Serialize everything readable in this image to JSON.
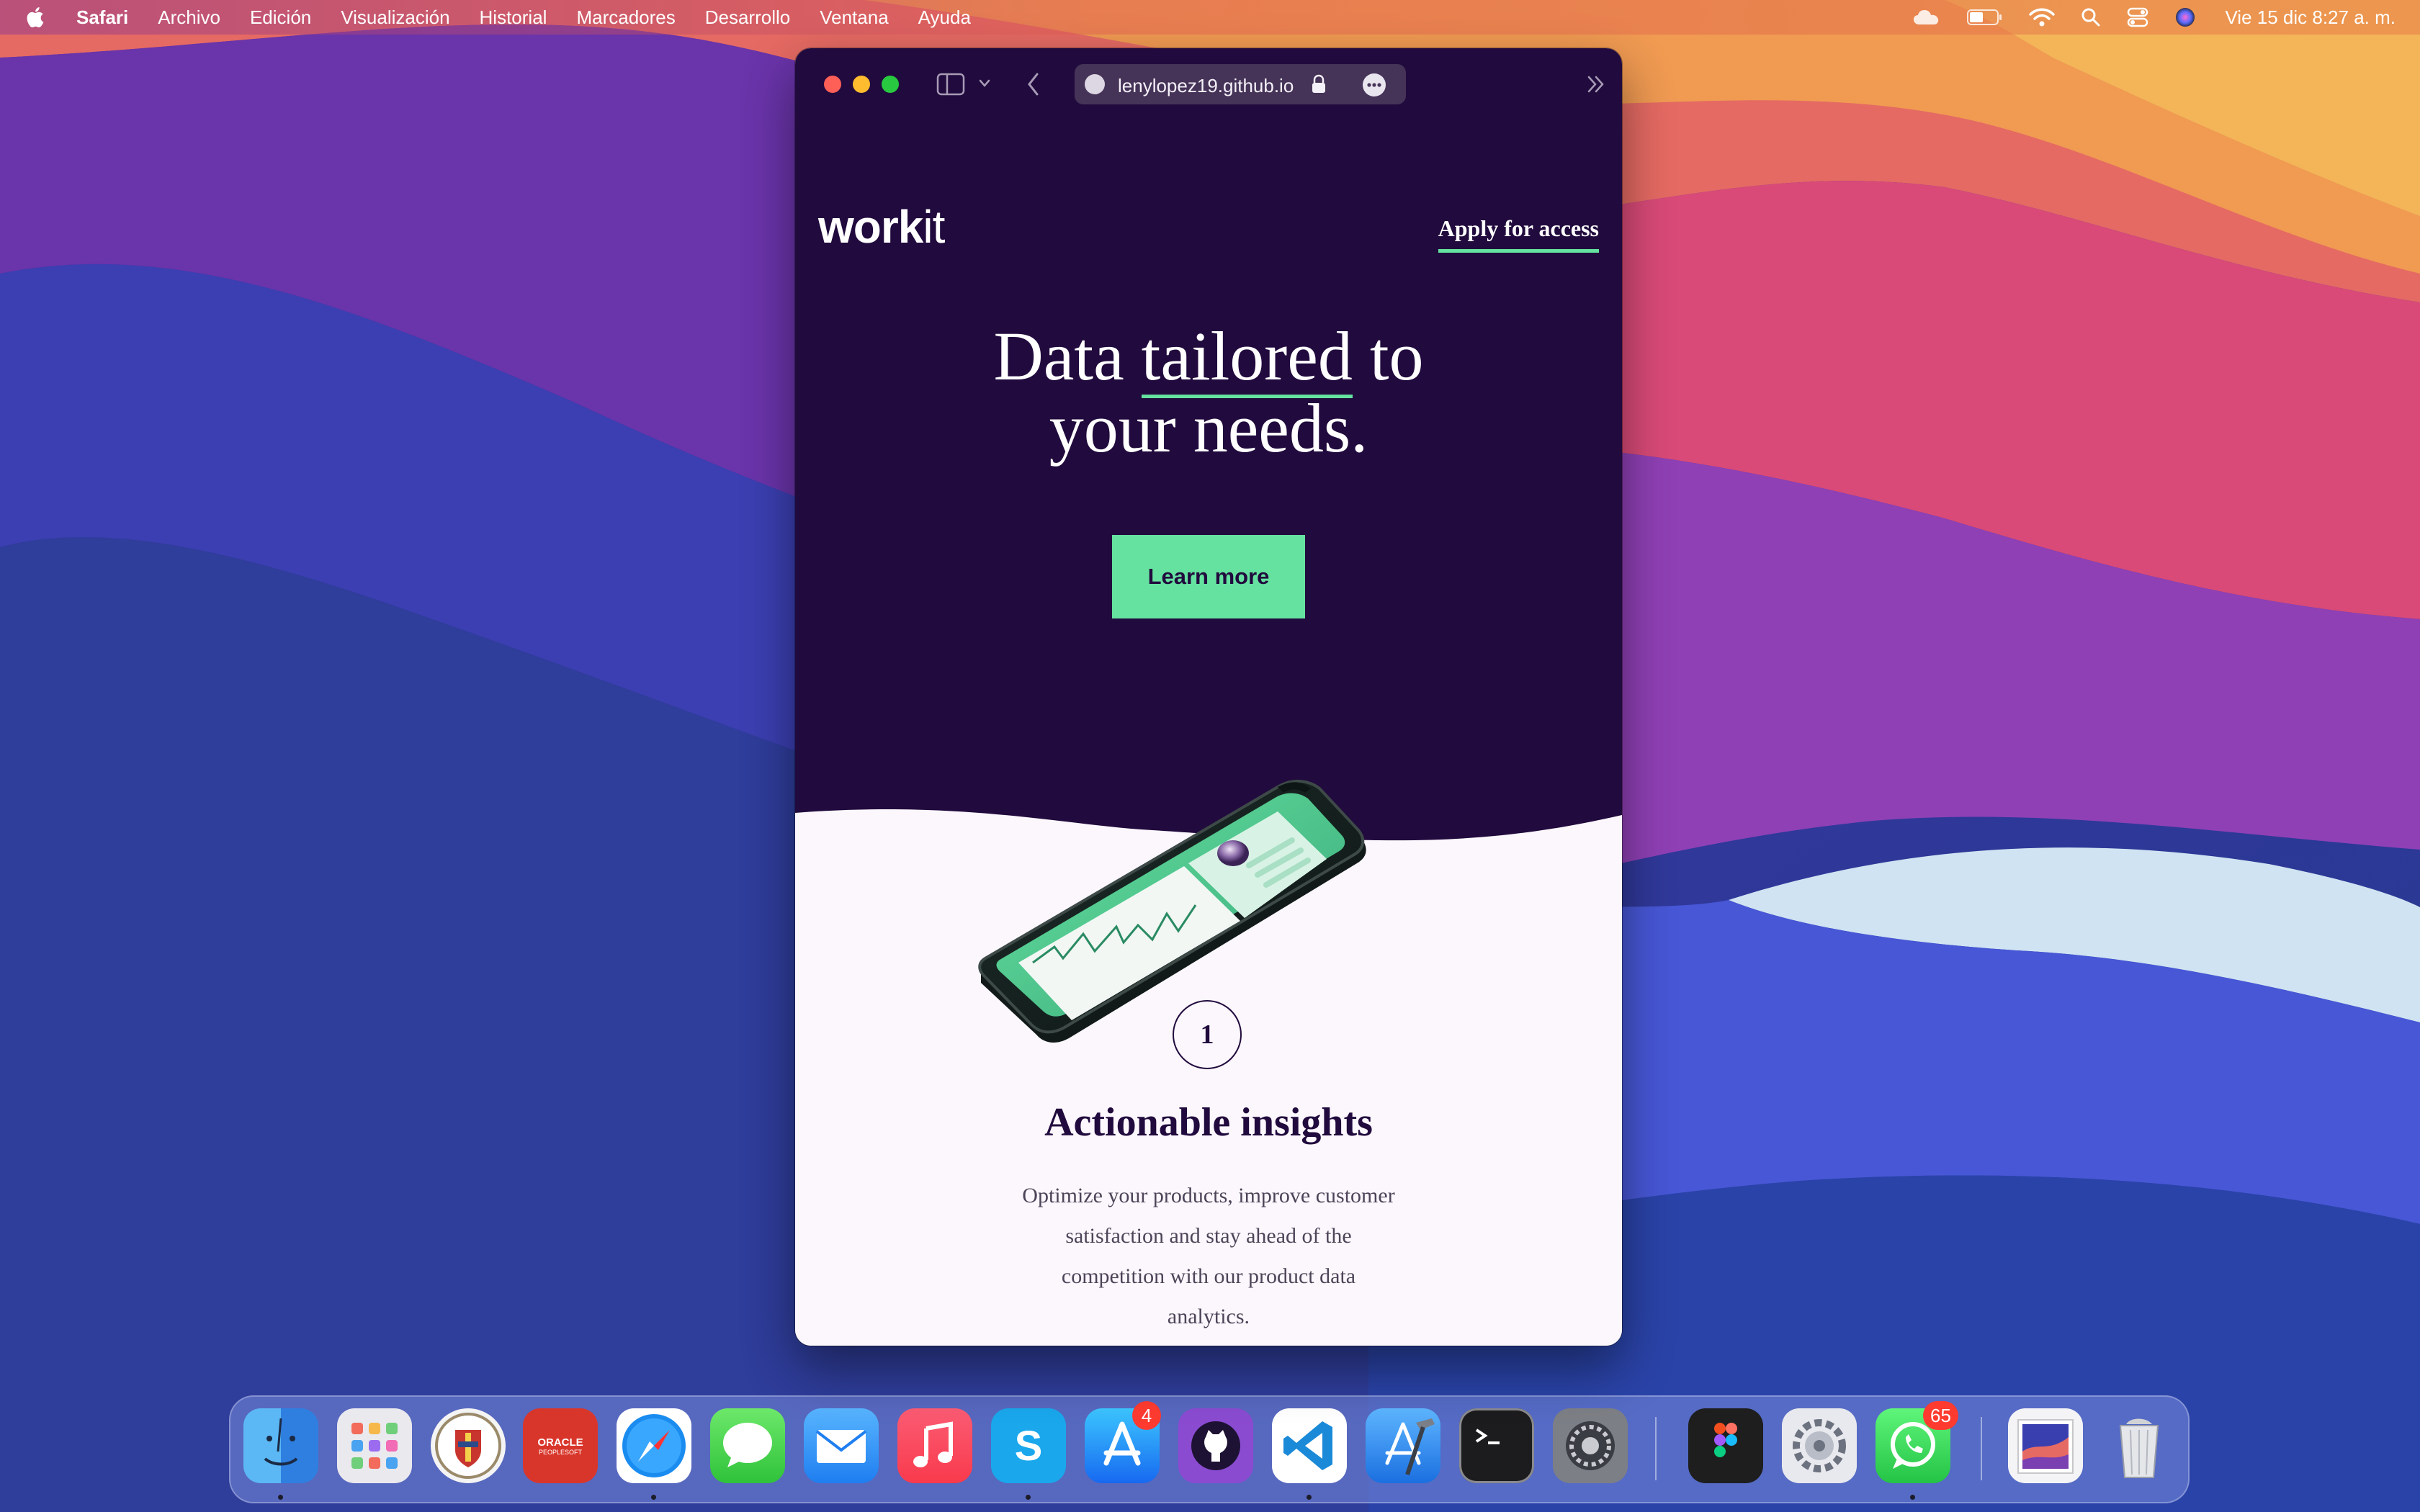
{
  "menubar": {
    "app_name": "Safari",
    "menus": [
      "Archivo",
      "Edición",
      "Visualización",
      "Historial",
      "Marcadores",
      "Desarrollo",
      "Ventana",
      "Ayuda"
    ],
    "clock": "Vie 15 dic  8:27 a. m.",
    "status_icons": [
      "icloud-icon",
      "battery-icon",
      "wifi-icon",
      "spotlight-icon",
      "control-center-icon",
      "siri-icon"
    ]
  },
  "browser": {
    "url": "lenylopez19.github.io",
    "toolbar_icons": [
      "sidebar-icon",
      "chevron-down-icon",
      "back-icon",
      "lock-icon",
      "more-icon",
      "double-chevron-icon"
    ]
  },
  "site": {
    "logo_bold": "work",
    "logo_light": "it",
    "nav_link": "Apply for access",
    "headline": {
      "part1": "Data ",
      "highlight": "tailored",
      "part2": " to",
      "line2": "your needs."
    },
    "cta": "Learn more",
    "feature": {
      "number": "1",
      "title": "Actionable insights",
      "text": "Optimize your products, improve customer satisfaction and stay ahead of the competition with our product data analytics."
    },
    "colors": {
      "hero_background": "#210a3d",
      "accent": "#65e2a0",
      "page_background": "#fbf7fd"
    }
  },
  "dock": {
    "apps": [
      "Finder",
      "Launchpad",
      "Institution",
      "Oracle PeopleSoft",
      "Safari",
      "Messages",
      "Mail",
      "Music",
      "Skype",
      "App Store",
      "GitHub Desktop",
      "Visual Studio Code",
      "Xcode",
      "Terminal",
      "System Settings",
      "Figma",
      "System Preferences",
      "WhatsApp",
      "Preview",
      "Trash"
    ],
    "oracle_label_1": "ORACLE",
    "oracle_label_2": "PEOPLESOFT",
    "skype_letter": "S",
    "badges": {
      "app_store": "4",
      "whatsapp": "65"
    }
  }
}
